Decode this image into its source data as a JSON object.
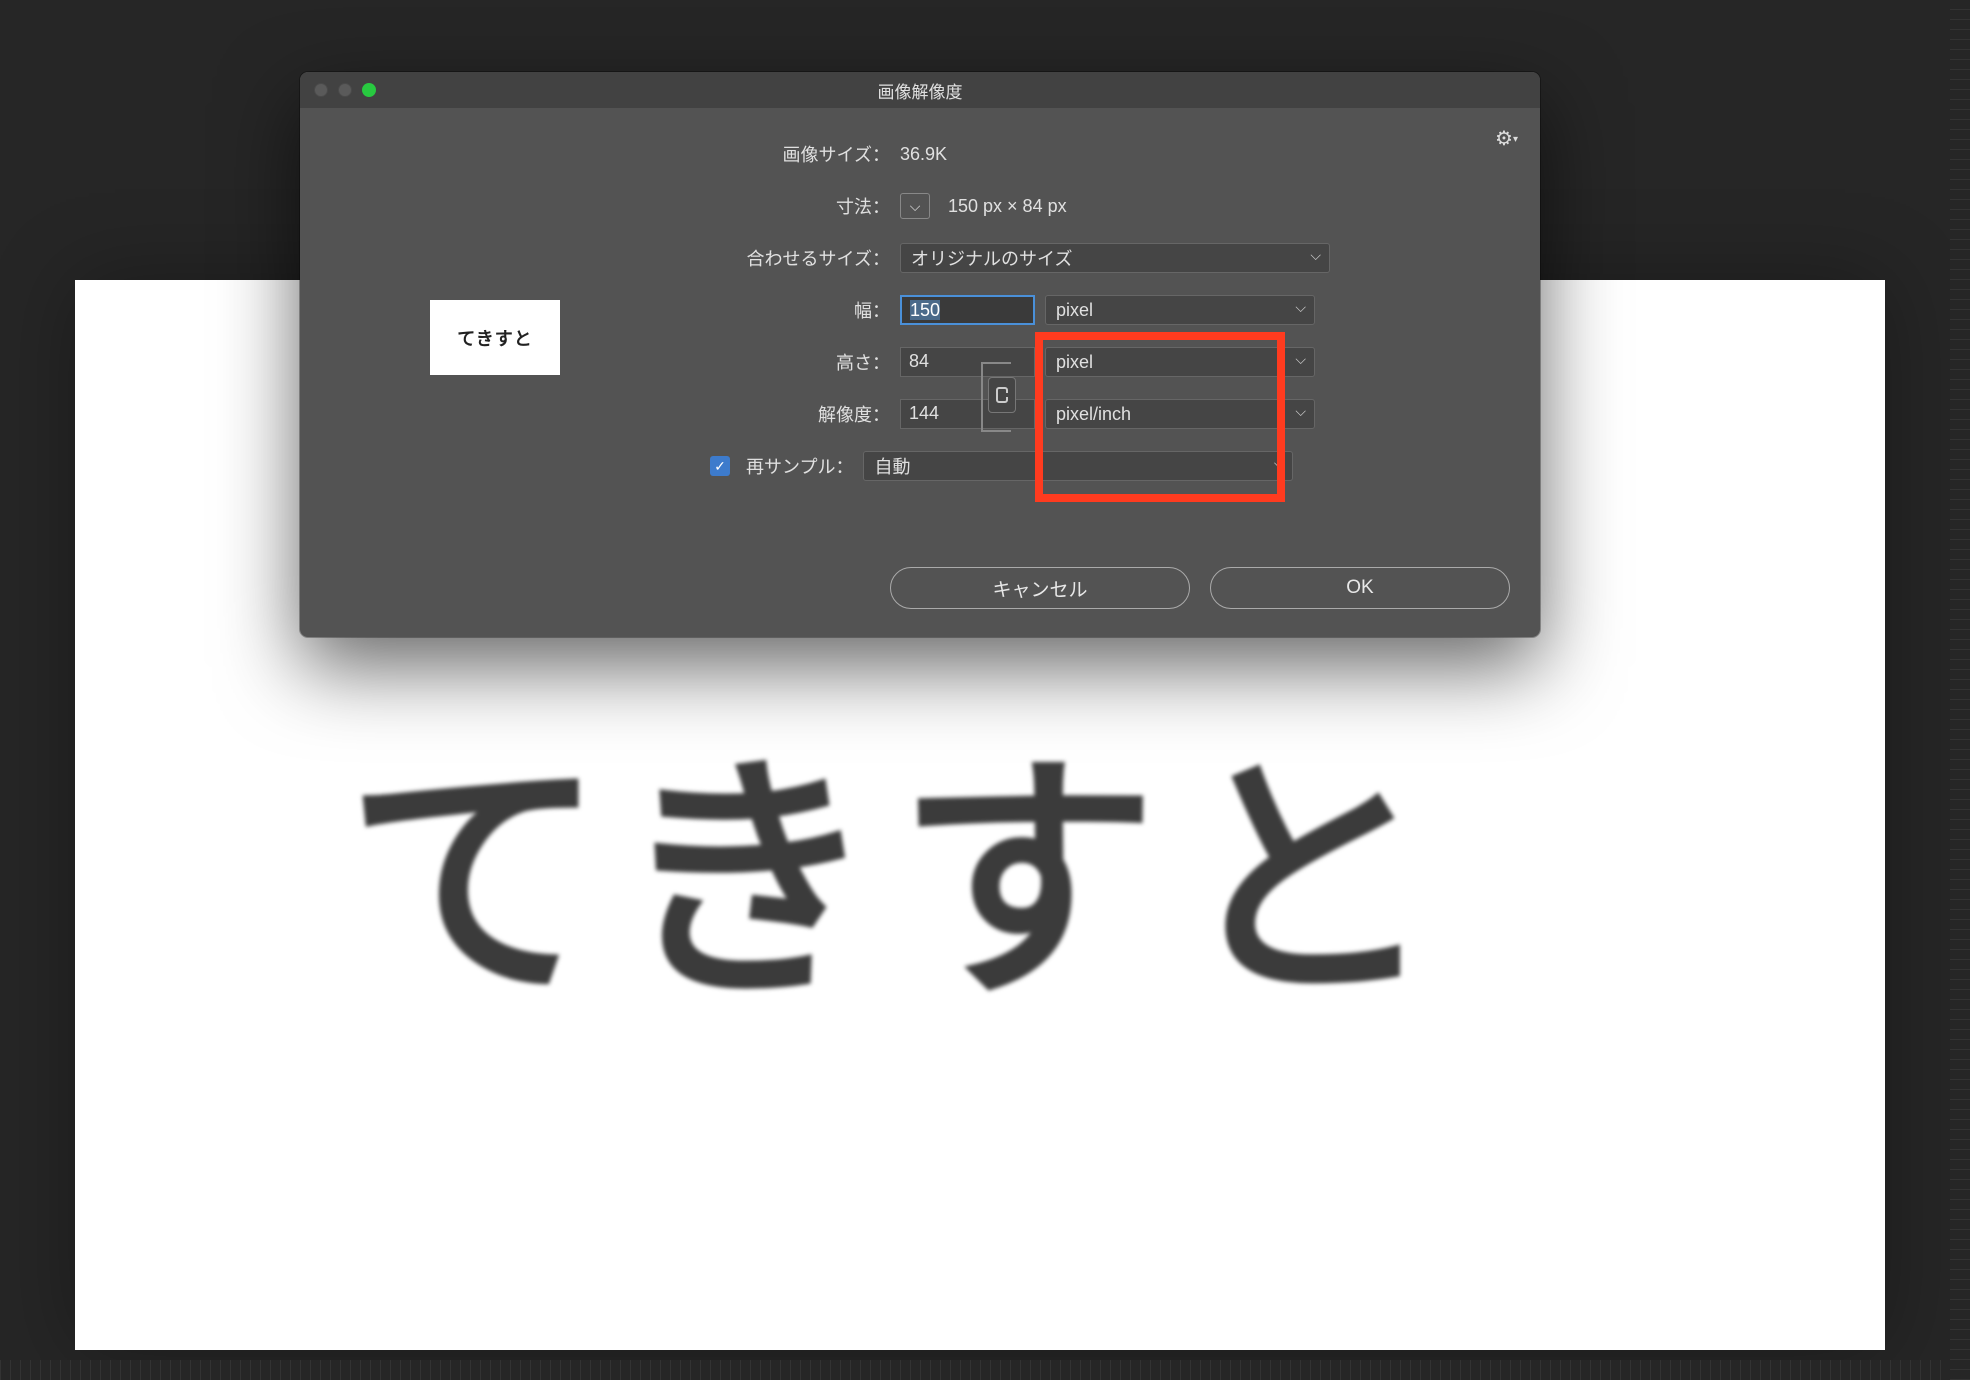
{
  "dialog": {
    "title": "画像解像度",
    "image_size_label": "画像サイズ：",
    "image_size_value": "36.9K",
    "dimensions_label": "寸法：",
    "dimensions_value": "150 px × 84 px",
    "fit_label": "合わせるサイズ：",
    "fit_value": "オリジナルのサイズ",
    "width_label": "幅：",
    "width_value": "150",
    "width_unit": "pixel",
    "height_label": "高さ：",
    "height_value": "84",
    "height_unit": "pixel",
    "resolution_label": "解像度：",
    "resolution_value": "144",
    "resolution_unit": "pixel/inch",
    "resample_label": "再サンプル：",
    "resample_value": "自動",
    "cancel_label": "キャンセル",
    "ok_label": "OK"
  },
  "preview_text": "てきすと",
  "canvas_text": "てきすと"
}
